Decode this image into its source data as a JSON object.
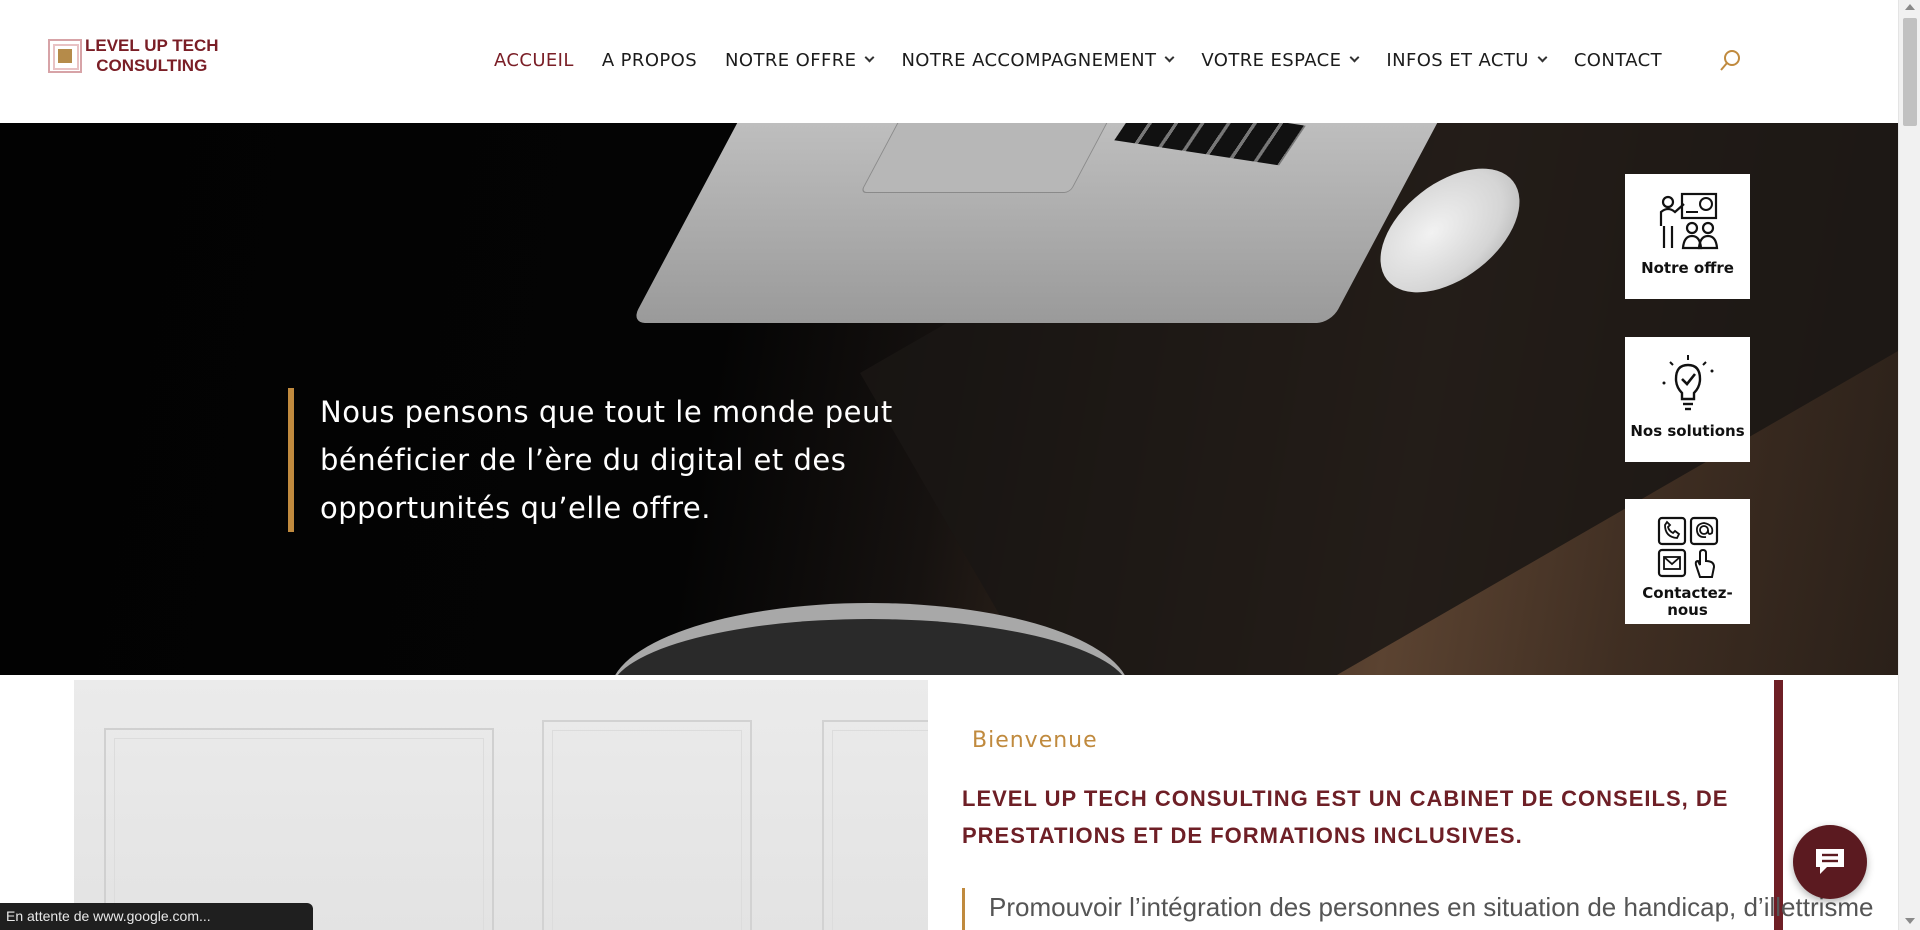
{
  "logo": {
    "line1": "LEVEL UP TECH",
    "line2": "CONSULTING"
  },
  "nav": {
    "items": [
      {
        "label": "ACCUEIL",
        "active": true,
        "dropdown": false
      },
      {
        "label": "A PROPOS",
        "active": false,
        "dropdown": false
      },
      {
        "label": "NOTRE OFFRE",
        "active": false,
        "dropdown": true
      },
      {
        "label": "NOTRE ACCOMPAGNEMENT",
        "active": false,
        "dropdown": true
      },
      {
        "label": "VOTRE ESPACE",
        "active": false,
        "dropdown": true
      },
      {
        "label": "INFOS ET ACTU",
        "active": false,
        "dropdown": true
      },
      {
        "label": "CONTACT",
        "active": false,
        "dropdown": false
      }
    ],
    "search_icon": "search-icon"
  },
  "hero": {
    "quote": "Nous pensons que tout le monde peut bénéficier de l’ère du digital et des opportunités qu’elle offre.",
    "cards": [
      {
        "label": "Notre offre",
        "icon": "presentation-icon"
      },
      {
        "label": "Nos solutions",
        "icon": "lightbulb-check-icon"
      },
      {
        "label": "Contactez-nous",
        "icon": "contact-grid-icon"
      }
    ]
  },
  "welcome": {
    "kicker": "Bienvenue",
    "title": "LEVEL UP TECH CONSULTING EST UN CABINET DE CONSEILS, DE PRESTATIONS ET DE FORMATIONS INCLUSIVES.",
    "body": "Promouvoir l’intégration des personnes en situation de handicap, d’illettrisme"
  },
  "status_bar": {
    "text": "En attente de www.google.com..."
  },
  "colors": {
    "brand": "#7a1e26",
    "accent": "#c08a3e",
    "dark_brand": "#5b1a20"
  }
}
